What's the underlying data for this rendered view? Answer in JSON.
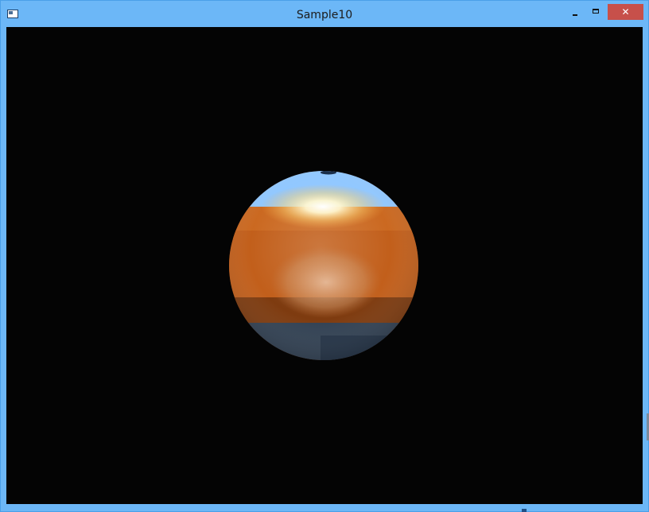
{
  "window": {
    "title": "Sample10",
    "close_glyph": "✕",
    "controls": {
      "minimize_icon": "minimize-icon",
      "maximize_icon": "maximize-icon",
      "close_icon": "close-icon"
    }
  },
  "colors": {
    "frame": "#6cb7f7",
    "viewport_background": "#040404",
    "sphere_orange": "#c9641a",
    "sky_reflection": "#8ec6ff",
    "close_button": "#c7504a"
  }
}
